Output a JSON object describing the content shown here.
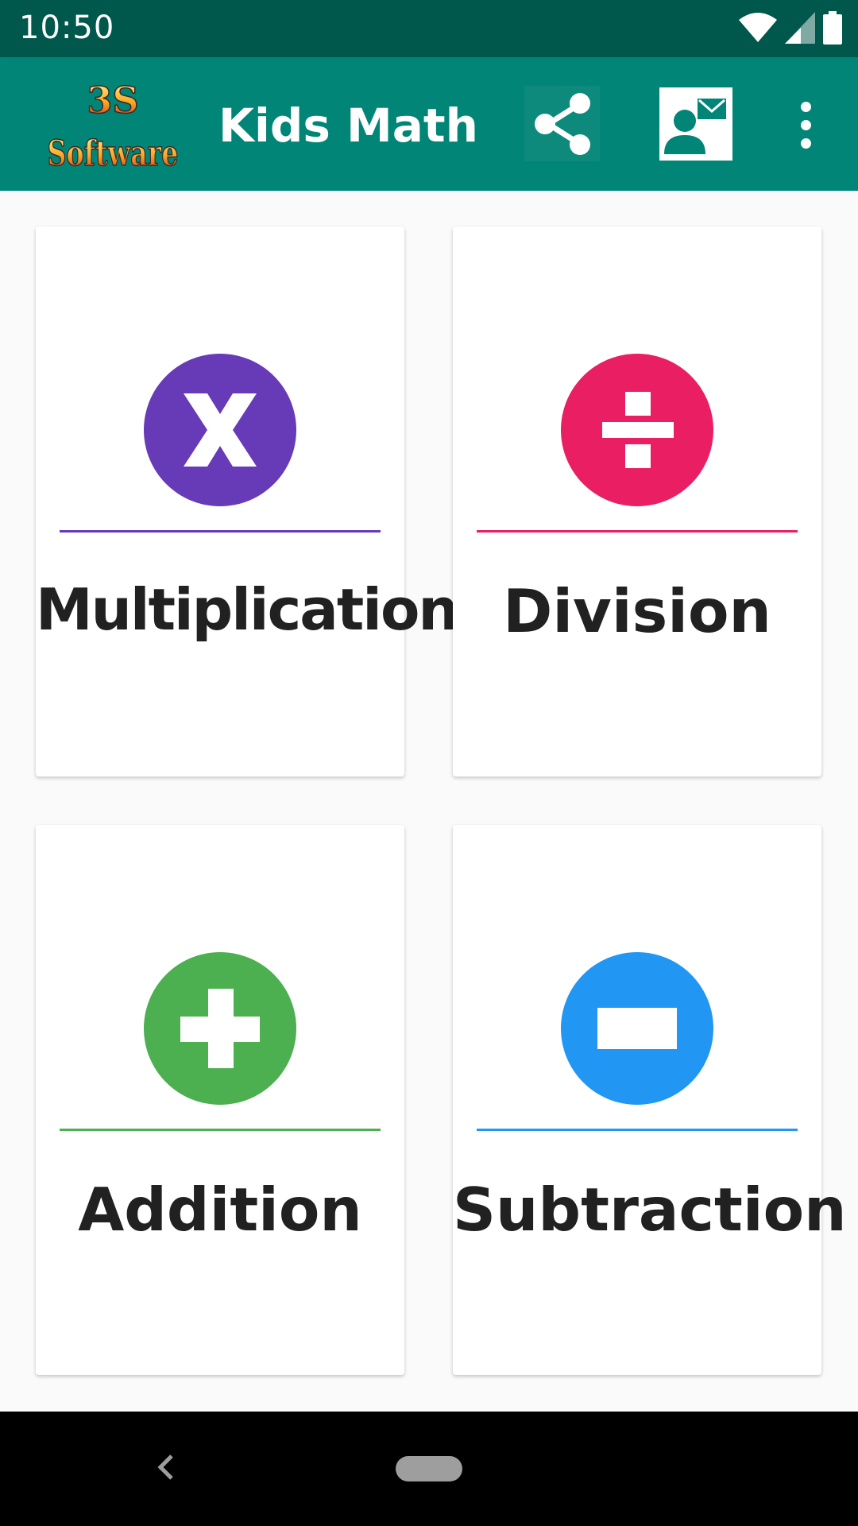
{
  "status_bar": {
    "time": "10:50",
    "icons": [
      "wifi-icon",
      "cell-signal-icon",
      "battery-icon"
    ]
  },
  "app_bar": {
    "logo_text_line1": "3S",
    "logo_text_line2": "Software",
    "title": "Kids Math",
    "actions": [
      "share-icon",
      "contact-mail-icon",
      "more-vert-icon"
    ]
  },
  "cards": [
    {
      "label": "Multiplication",
      "icon": "multiply-icon",
      "color": "#673ab7"
    },
    {
      "label": "Division",
      "icon": "divide-icon",
      "color": "#e91e63"
    },
    {
      "label": "Addition",
      "icon": "plus-icon",
      "color": "#4caf50"
    },
    {
      "label": "Subtraction",
      "icon": "minus-icon",
      "color": "#2196f3"
    }
  ],
  "colors": {
    "status_bar": "#00574b",
    "app_bar": "#008577",
    "background": "#fafafa",
    "text": "#212121"
  },
  "nav_bar": {
    "buttons": [
      "back-icon",
      "home-pill"
    ]
  }
}
